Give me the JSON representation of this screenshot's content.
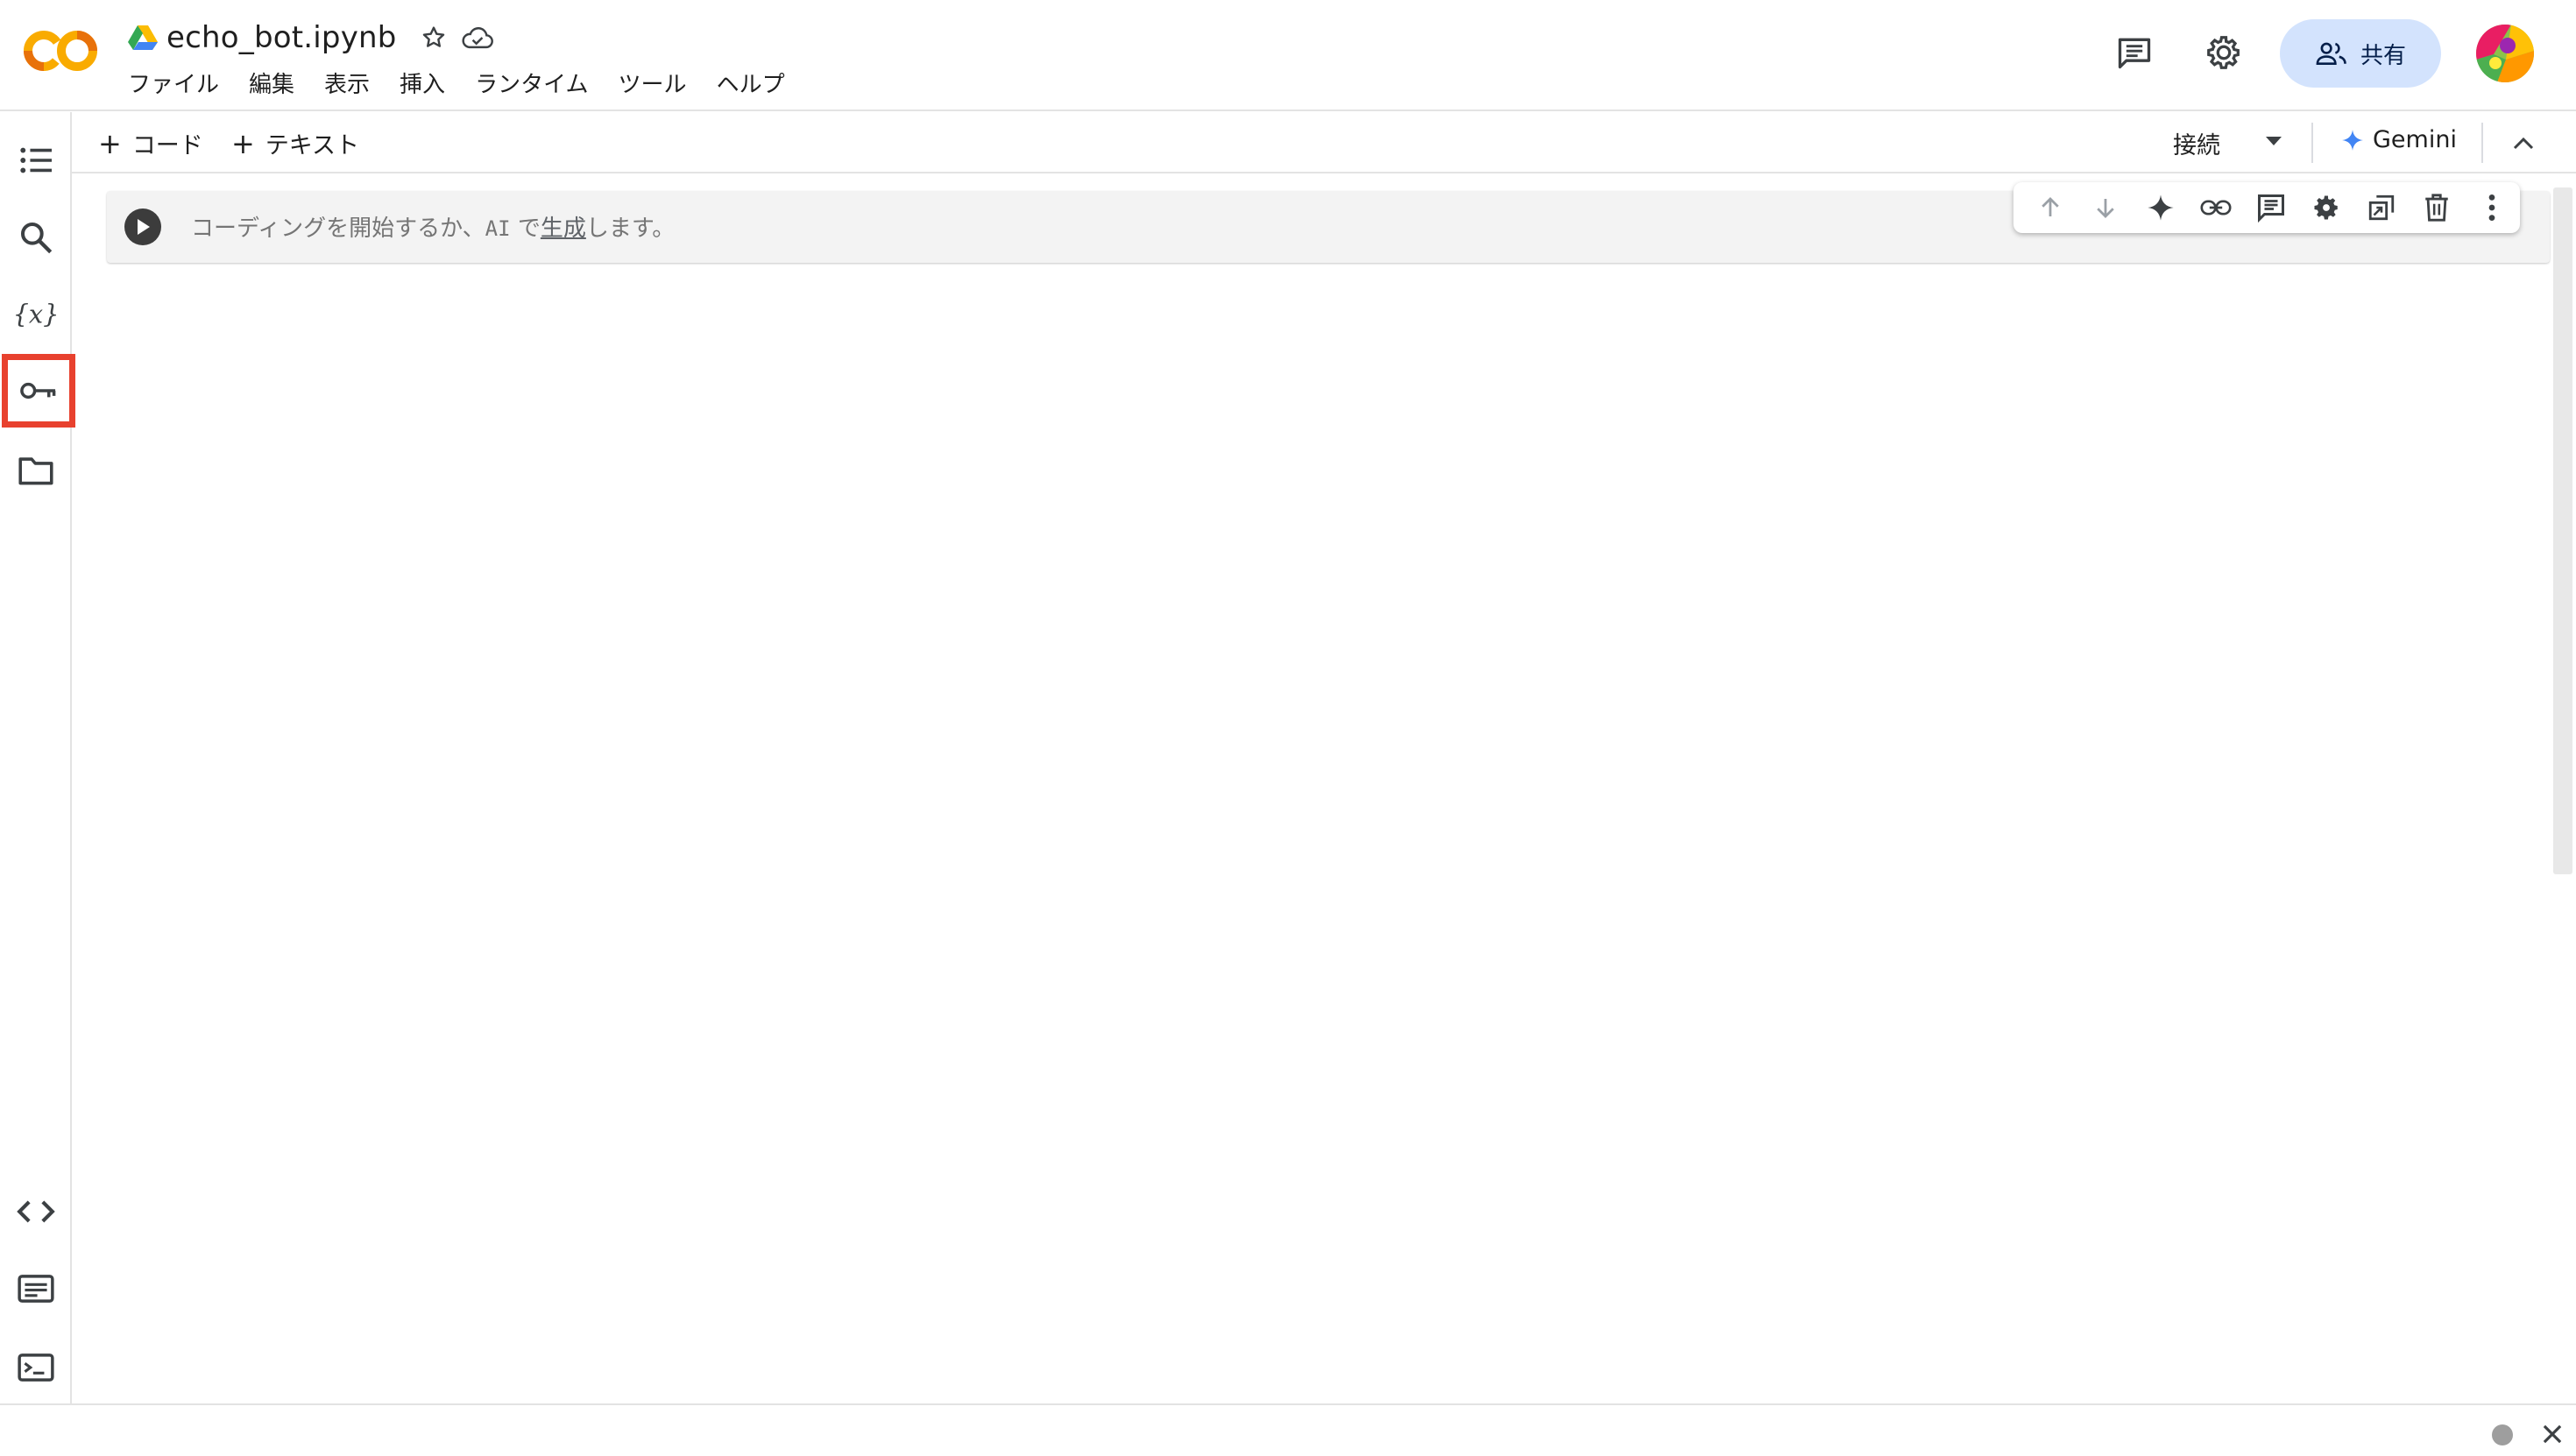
{
  "header": {
    "notebook_title": "echo_bot.ipynb",
    "menu": [
      "ファイル",
      "編集",
      "表示",
      "挿入",
      "ランタイム",
      "ツール",
      "ヘルプ"
    ],
    "share_label": "共有"
  },
  "toolbar": {
    "add_code_label": "コード",
    "add_text_label": "テキスト",
    "connect_label": "接続",
    "gemini_label": "Gemini"
  },
  "cell": {
    "placeholder_prefix": "コーディングを開始するか、",
    "placeholder_ai": "AI",
    "placeholder_mid": " で",
    "placeholder_link": "生成",
    "placeholder_suffix": "します。"
  },
  "rail": {
    "items": [
      "table-of-contents-icon",
      "search-icon",
      "variables-icon",
      "secrets-key-icon",
      "files-folder-icon"
    ],
    "bottom_items": [
      "code-snippets-icon",
      "command-palette-icon",
      "terminal-icon"
    ],
    "selected": "secrets-key-icon"
  },
  "colors": {
    "accent": "#d3e3fd",
    "highlight": "#e8412e",
    "logo_orange": "#f9ab00",
    "logo_dark_orange": "#e8710a",
    "gemini_blue": "#4285f4"
  }
}
